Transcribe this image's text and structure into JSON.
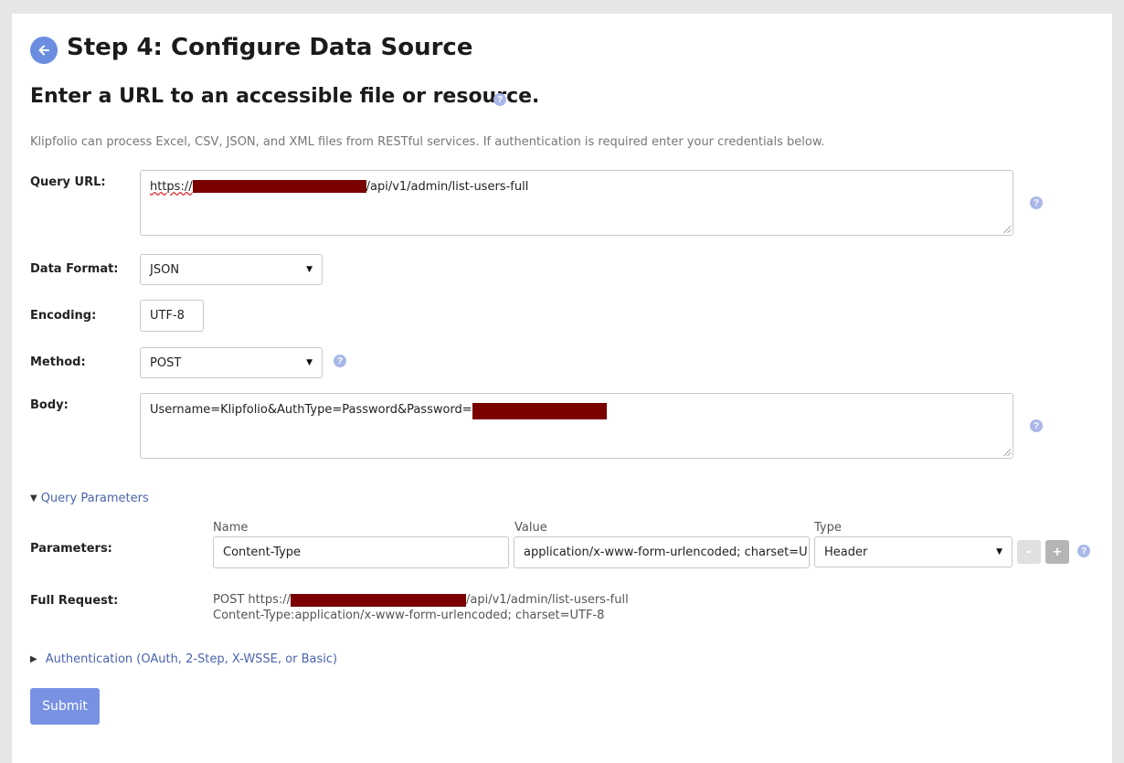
{
  "header": {
    "title": "Step 4: Configure Data Source",
    "subtitle": "Enter a URL to an accessible file or resource.",
    "description": "Klipfolio can process Excel, CSV, JSON, and XML files from RESTful services. If authentication is required enter your credentials below."
  },
  "form": {
    "query_url": {
      "label": "Query URL:",
      "prefix": "https://",
      "suffix": "/api/v1/admin/list-users-full"
    },
    "data_format": {
      "label": "Data Format:",
      "value": "JSON"
    },
    "encoding": {
      "label": "Encoding:",
      "value": "UTF-8"
    },
    "method": {
      "label": "Method:",
      "value": "POST"
    },
    "body": {
      "label": "Body:",
      "prefix": "Username=Klipfolio&AuthType=Password&Password="
    }
  },
  "query_params": {
    "toggle_label": "Query Parameters",
    "parameters_label": "Parameters:",
    "columns": {
      "name": "Name",
      "value": "Value",
      "type": "Type"
    },
    "row": {
      "name": "Content-Type",
      "value": "application/x-www-form-urlencoded; charset=U",
      "type": "Header"
    },
    "remove_label": "-",
    "add_label": "+"
  },
  "full_request": {
    "label": "Full Request:",
    "line1_prefix": "POST https://",
    "line1_suffix": "/api/v1/admin/list-users-full",
    "line2": "Content-Type:application/x-www-form-urlencoded; charset=UTF-8"
  },
  "authentication": {
    "toggle_label": "Authentication (OAuth, 2-Step, X-WSSE, or Basic)"
  },
  "submit_label": "Submit",
  "help_glyph": "?",
  "colors": {
    "accent": "#6b8ee0",
    "link": "#4a64ad",
    "redaction": "#7a0000",
    "submit": "#7891e3"
  }
}
